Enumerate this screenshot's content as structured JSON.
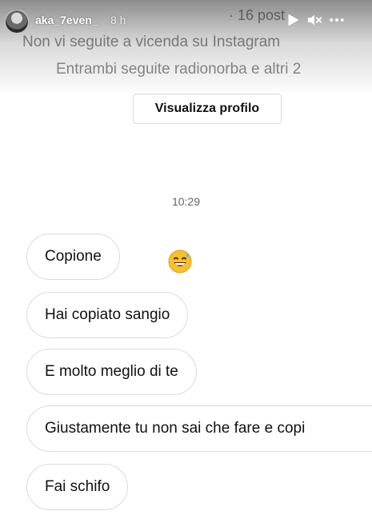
{
  "story": {
    "username": "aka_7even_",
    "time_ago": "8 h",
    "icons": {
      "avatar": "avatar",
      "play": "play-icon",
      "mute": "mute-icon",
      "more": "more-icon"
    }
  },
  "profile_info": {
    "posts": "· 16 post",
    "line1": "Non vi seguite a vicenda su Instagram",
    "line2": "Entrambi seguite radionorba e altri 2",
    "button_label": "Visualizza profilo"
  },
  "chat": {
    "timestamp": "10:29",
    "messages": [
      {
        "text": "Copione",
        "reaction_icon": "grinning-sweat-emoji-icon"
      },
      {
        "text": "Hai copiato sangio"
      },
      {
        "text": "E molto meglio di te"
      },
      {
        "text": "Giustamente tu non sai che fare e copi"
      },
      {
        "text": "Fai schifo"
      }
    ]
  },
  "colors": {
    "text": "#111111",
    "muted_text": "#8e8e8e",
    "bubble_border": "#dbdbdb",
    "background": "#ffffff",
    "emoji": "#f7c12e"
  }
}
